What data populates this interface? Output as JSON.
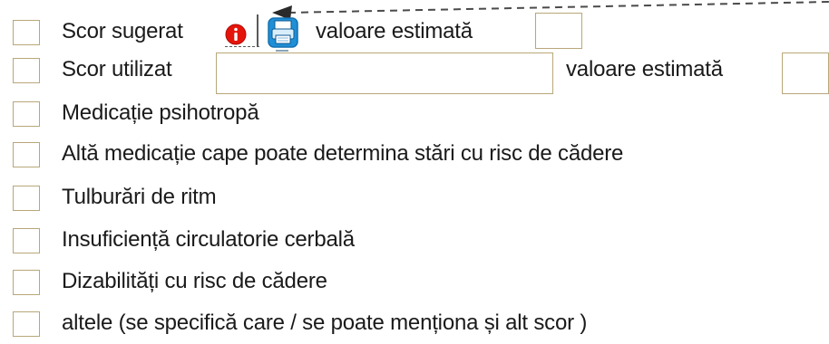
{
  "rows": [
    {
      "label": "Scor sugerat"
    },
    {
      "label": "Scor utilizat"
    },
    {
      "label": "Medicație psihotropă"
    },
    {
      "label": "Altă medicație cape poate determina stări cu risc de cădere"
    },
    {
      "label": "Tulburări de ritm"
    },
    {
      "label": "Insuficiență circulatorie cerbală"
    },
    {
      "label": "Dizabilități cu risc de cădere"
    },
    {
      "label": "altele (se specifică care / se poate menționa și alt scor )"
    }
  ],
  "estimated_label_1": "valoare estimată",
  "estimated_label_2": "valoare estimată",
  "fields": {
    "suggested_estimated_value": "",
    "used_score_value": "",
    "used_estimated_value": ""
  },
  "icons": {
    "info": "info-icon",
    "print": "printer-icon"
  },
  "colors": {
    "border": "#b8a77a",
    "info_red": "#e5140b",
    "print_blue": "#1f8fd6",
    "text": "#1a1a1a"
  }
}
